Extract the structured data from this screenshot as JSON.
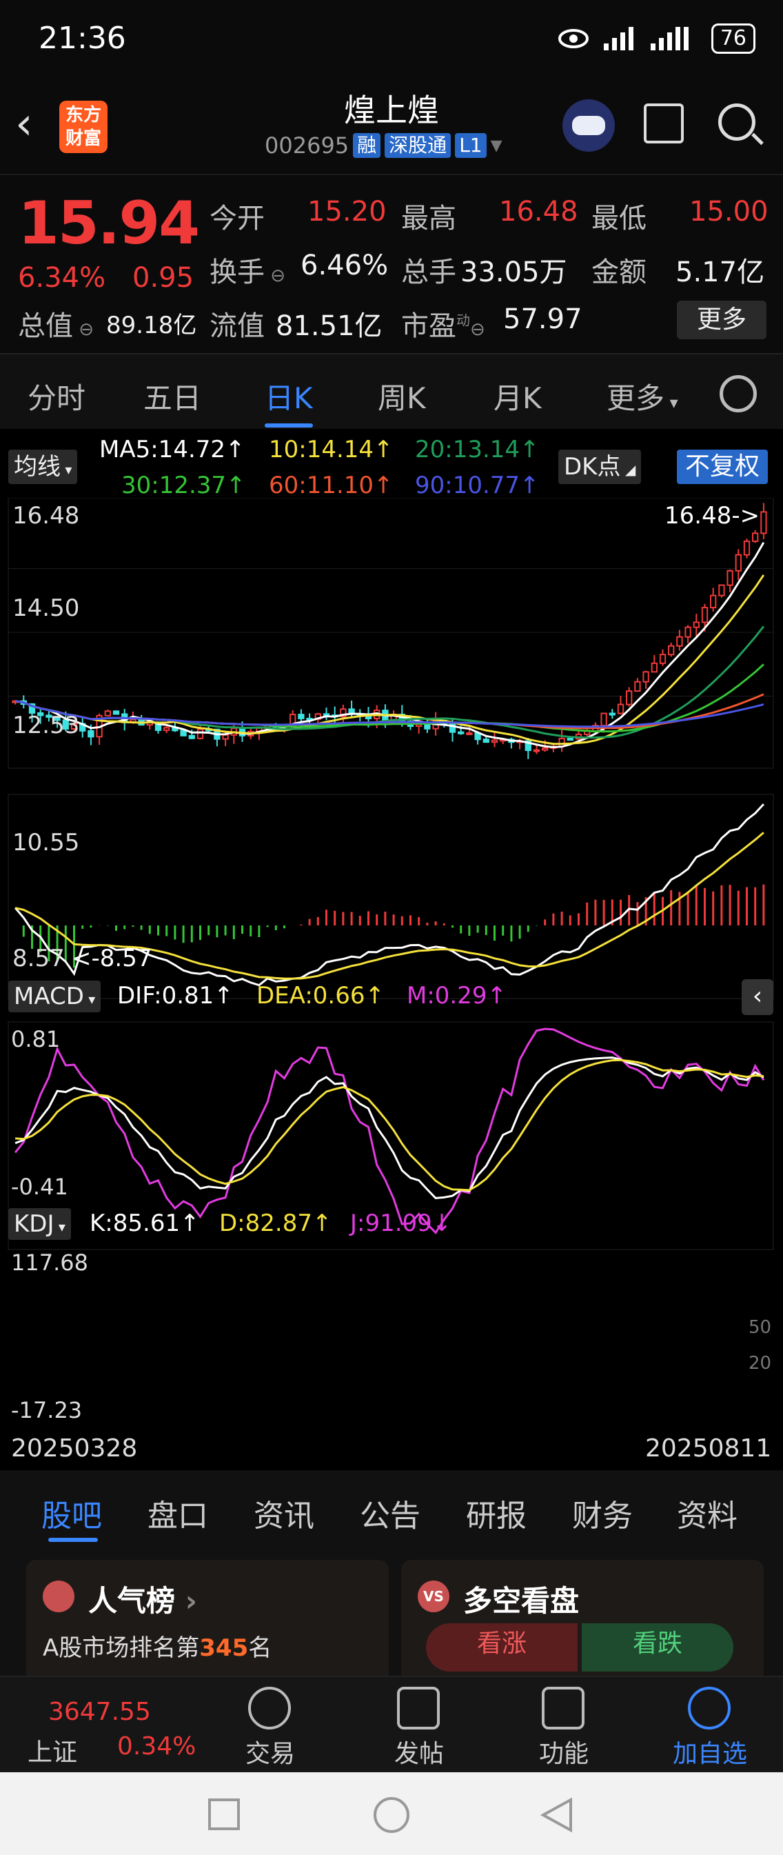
{
  "status": {
    "time": "21:36",
    "battery": "76"
  },
  "header": {
    "logo": [
      "东方",
      "财富"
    ],
    "title": "煌上煌",
    "code": "002695",
    "tags": [
      "融",
      "深股通",
      "L1"
    ]
  },
  "quote": {
    "price": "15.94",
    "change_pct": "6.34%",
    "change_amt": "0.95",
    "row1": [
      {
        "label": "今开",
        "value": "15.20"
      },
      {
        "label": "最高",
        "value": "16.48"
      },
      {
        "label": "最低",
        "value": "15.00"
      }
    ],
    "row2": [
      {
        "label": "换手",
        "value": "6.46%"
      },
      {
        "label": "总手",
        "value": "33.05万"
      },
      {
        "label": "金额",
        "value": "5.17亿"
      }
    ],
    "row3": [
      {
        "label": "总值",
        "value": "89.18亿"
      },
      {
        "label": "流值",
        "value": "81.51亿"
      },
      {
        "label": "市盈",
        "sup": "动",
        "value": "57.97"
      }
    ],
    "more": "更多"
  },
  "tabs": {
    "items": [
      "分时",
      "五日",
      "日K",
      "周K",
      "月K",
      "更多"
    ],
    "active": 2
  },
  "chart_data": [
    {
      "type": "line",
      "title": "日K",
      "controls": {
        "ma_btn": "均线",
        "dk_btn": "DK点",
        "adjust_btn": "不复权"
      },
      "legend": [
        {
          "name": "MA5",
          "text": "MA5:14.72↑",
          "color": "#ffffff"
        },
        {
          "name": "10",
          "text": "10:14.14↑",
          "color": "#f5e13b"
        },
        {
          "name": "20",
          "text": "20:13.14↑",
          "color": "#1f9e5a"
        },
        {
          "name": "30",
          "text": "30:12.37↑",
          "color": "#35c535"
        },
        {
          "name": "60",
          "text": "60:11.10↑",
          "color": "#f0552f"
        },
        {
          "name": "90",
          "text": "90:10.77↑",
          "color": "#4a55e6"
        }
      ],
      "y_ticks": [
        "16.48",
        "14.50",
        "12.53",
        "10.55",
        "8.57"
      ],
      "ylim": [
        8.57,
        16.48
      ],
      "high_marker": "16.48->",
      "low_marker": "<-8.57",
      "x_labels": [
        "20250328",
        "20250811"
      ]
    },
    {
      "type": "line",
      "title": "MACD",
      "indicators": [
        {
          "name": "DIF",
          "text": "DIF:0.81↑",
          "color": "#ffffff"
        },
        {
          "name": "DEA",
          "text": "DEA:0.66↑",
          "color": "#f5e13b"
        },
        {
          "name": "M",
          "text": "M:0.29↑",
          "color": "#e23be0"
        }
      ],
      "y_ticks": [
        "0.81",
        "-0.41"
      ],
      "ylim": [
        -0.41,
        0.81
      ]
    },
    {
      "type": "line",
      "title": "KDJ",
      "indicators": [
        {
          "name": "K",
          "text": "K:85.61↑",
          "color": "#ffffff"
        },
        {
          "name": "D",
          "text": "D:82.87↑",
          "color": "#f5e13b"
        },
        {
          "name": "J",
          "text": "J:91.09↓",
          "color": "#e23be0"
        }
      ],
      "y_ticks": [
        "117.68",
        "-17.23"
      ],
      "ref_ticks": [
        "50",
        "20"
      ],
      "ylim": [
        -17.23,
        117.68
      ]
    }
  ],
  "subtabs": {
    "items": [
      "股吧",
      "盘口",
      "资讯",
      "公告",
      "研报",
      "财务",
      "资料"
    ],
    "active": 0
  },
  "cards": {
    "left_title": "人气榜",
    "left_text_pre": "A股市场排名第",
    "left_rank": "345",
    "left_text_post": "名",
    "right_title": "多空看盘",
    "up_label": "看涨",
    "down_label": "看跌"
  },
  "bottom_nav": {
    "index_value": "3647.55",
    "index_name": "上证",
    "index_change": "0.34%",
    "items": [
      "交易",
      "发帖",
      "功能",
      "加自选"
    ]
  }
}
